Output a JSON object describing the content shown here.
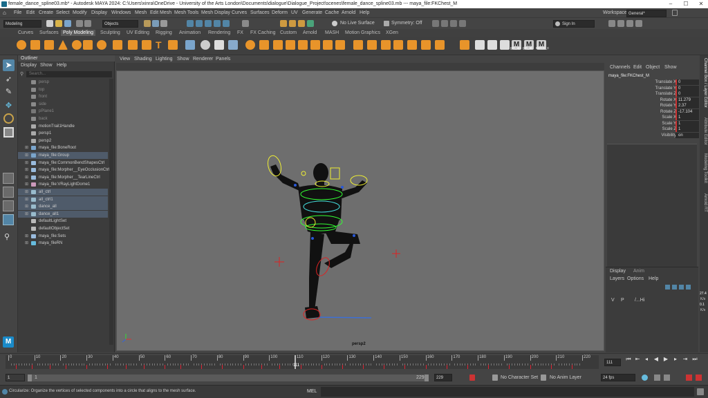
{
  "window": {
    "title": "female_dance_spline03.mb* - Autodesk MAYA 2024: C:\\Users\\xinra\\OneDrive - University of the Arts London\\Documents\\dialogue\\Dialogue_Project\\scenes\\female_dance_spline03.mb  ---  maya_file:FKChest_M",
    "minimize": "–",
    "maximize": "☐",
    "close": "✕"
  },
  "menubar": {
    "items": [
      "File",
      "Edit",
      "Create",
      "Select",
      "Modify",
      "Display",
      "Windows",
      "Mesh",
      "Edit Mesh",
      "Mesh Tools",
      "Mesh Display",
      "Curves",
      "Surfaces",
      "Deform",
      "UV",
      "Generate",
      "Cache",
      "Arnold",
      "Help"
    ],
    "workspace_label": "Workspace :",
    "workspace_value": "General*"
  },
  "statusline": {
    "mode": "Modeling",
    "objects": "Objects",
    "live_surface": "No Live Surface",
    "symmetry": "Symmetry: Off",
    "sign_in": "Sign In"
  },
  "shelf_tabs": [
    "Curves",
    "Surfaces",
    "Poly Modeling",
    "Sculpting",
    "UV Editing",
    "Rigging",
    "Animation",
    "Rendering",
    "FX",
    "FX Caching",
    "Custom",
    "Arnold",
    "MASH",
    "Motion Graphics",
    "XGen"
  ],
  "shelf_active": "Poly Modeling",
  "shelf_text": [
    "girl_up",
    "girl_all",
    "dance_c"
  ],
  "outliner": {
    "title": "Outliner",
    "menu": [
      "Display",
      "Show",
      "Help"
    ],
    "search_placeholder": "Search...",
    "items": [
      {
        "label": "persp",
        "dim": true,
        "expand": false,
        "sel": false
      },
      {
        "label": "top",
        "dim": true,
        "expand": false,
        "sel": false
      },
      {
        "label": "front",
        "dim": true,
        "expand": false,
        "sel": false
      },
      {
        "label": "side",
        "dim": true,
        "expand": false,
        "sel": false
      },
      {
        "label": "pPlane1",
        "dim": true,
        "expand": false,
        "sel": false
      },
      {
        "label": "back",
        "dim": true,
        "expand": false,
        "sel": false
      },
      {
        "label": "motionTrail1Handle",
        "dim": false,
        "expand": false,
        "sel": false
      },
      {
        "label": "persp1",
        "dim": false,
        "expand": false,
        "sel": false
      },
      {
        "label": "persp2",
        "dim": false,
        "expand": false,
        "sel": false
      },
      {
        "label": "maya_file:BoneRoot",
        "dim": false,
        "expand": true,
        "sel": false
      },
      {
        "label": "maya_file:Group",
        "dim": false,
        "expand": true,
        "sel": true
      },
      {
        "label": "maya_file:CommonBendShapesCtrl",
        "dim": false,
        "expand": true,
        "sel": false
      },
      {
        "label": "maya_file:Morpher__EyeOcclusionCtrl",
        "dim": false,
        "expand": true,
        "sel": false
      },
      {
        "label": "maya_file:Morpher__TearLineCtrl",
        "dim": false,
        "expand": true,
        "sel": false
      },
      {
        "label": "maya_file:VRayLightDome1",
        "dim": false,
        "expand": true,
        "sel": false
      },
      {
        "label": "all_ctrl",
        "dim": false,
        "expand": true,
        "sel": true
      },
      {
        "label": "all_ctrl1",
        "dim": false,
        "expand": true,
        "sel": true
      },
      {
        "label": "dance_all",
        "dim": false,
        "expand": true,
        "sel": true
      },
      {
        "label": "dance_all1",
        "dim": false,
        "expand": true,
        "sel": true
      },
      {
        "label": "defaultLightSet",
        "dim": false,
        "expand": false,
        "sel": false
      },
      {
        "label": "defaultObjectSet",
        "dim": false,
        "expand": false,
        "sel": false
      },
      {
        "label": "maya_file:Sets",
        "dim": false,
        "expand": true,
        "sel": false
      },
      {
        "label": "maya_fileRN",
        "dim": false,
        "expand": true,
        "sel": false
      }
    ]
  },
  "viewport": {
    "menu": [
      "View",
      "Shading",
      "Lighting",
      "Show",
      "Renderer",
      "Panels"
    ],
    "camera": "persp2"
  },
  "channelbox": {
    "menu": [
      "Channels",
      "Edit",
      "Object",
      "Show"
    ],
    "node": "maya_file:FKChest_M",
    "attrs": [
      {
        "name": "Translate X",
        "value": "0"
      },
      {
        "name": "Translate Y",
        "value": "0"
      },
      {
        "name": "Translate Z",
        "value": "0"
      },
      {
        "name": "Rotate X",
        "value": "11.279"
      },
      {
        "name": "Rotate Y",
        "value": "2.37"
      },
      {
        "name": "Rotate Z",
        "value": "-17.104"
      },
      {
        "name": "Scale X",
        "value": "1"
      },
      {
        "name": "Scale Y",
        "value": "1"
      },
      {
        "name": "Scale Z",
        "value": "1"
      },
      {
        "name": "Visibility",
        "value": "on"
      }
    ],
    "layer_tabs": [
      "Display",
      "Anim"
    ],
    "layer_menu": [
      "Layers",
      "Options",
      "Help"
    ],
    "layer_row": {
      "v": "V",
      "p": "P",
      "name": "/...Hi"
    },
    "side_tabs": [
      "Channel Box / Layer Editor",
      "Attribute Editor",
      "Modeling Toolkit",
      "Arnold RT"
    ],
    "side_values": [
      "27.4",
      "K/s",
      "0.1",
      "K/s"
    ]
  },
  "timeline": {
    "ticks": [
      "0",
      "10",
      "20",
      "30",
      "40",
      "50",
      "60",
      "70",
      "80",
      "90",
      "100",
      "110",
      "120",
      "130",
      "140",
      "150",
      "160",
      "170",
      "180",
      "190",
      "200",
      "210",
      "220"
    ],
    "current_frame": "111",
    "current_frame_field": "111"
  },
  "range": {
    "start": "1",
    "range_start_field": "1",
    "range_end_label": "229",
    "end_field": "229",
    "character_set": "No Character Set",
    "anim_layer": "No Anim Layer",
    "fps": "24 fps"
  },
  "cmdline": {
    "lang": "MEL",
    "help": "Circularize: Organize the vertices of selected components into a circle that aligns to the mesh surface."
  },
  "colors": {
    "accent_blue": "#5285a6",
    "key_red": "#d23",
    "select_green": "#3f3",
    "highlight_yellow": "#ee3",
    "shelf_orange": "#e8942a"
  }
}
